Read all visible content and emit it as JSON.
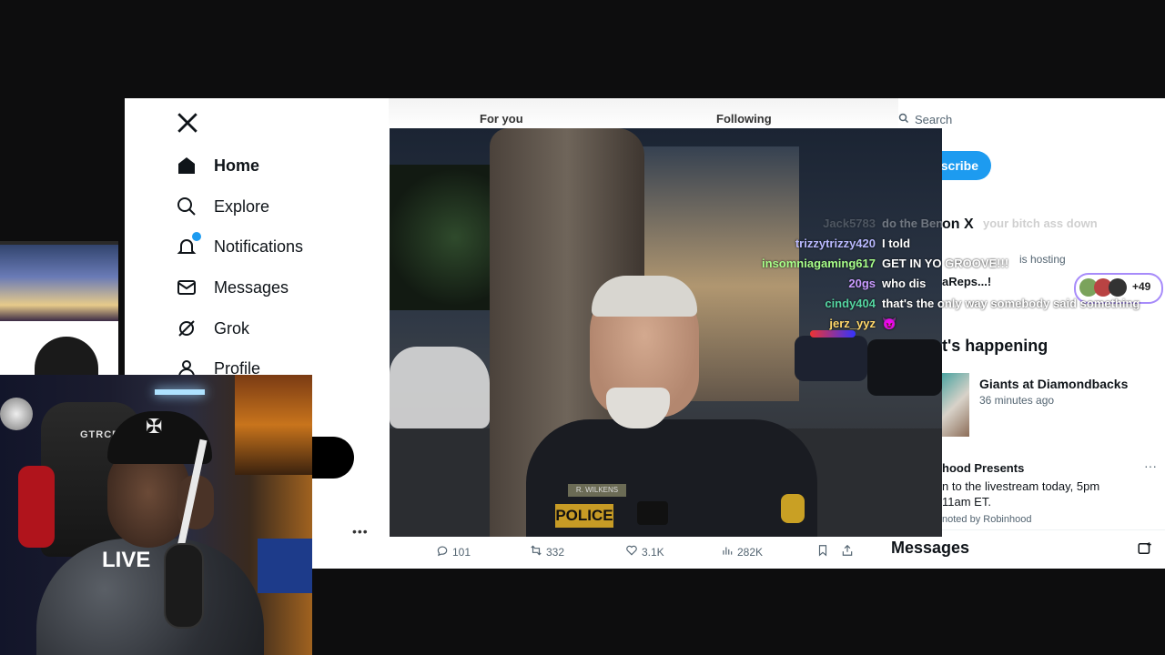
{
  "x_sidebar": {
    "items": [
      {
        "label": "Home"
      },
      {
        "label": "Explore"
      },
      {
        "label": "Notifications",
        "badge": "1"
      },
      {
        "label": "Messages"
      },
      {
        "label": "Grok"
      },
      {
        "label": "Profile"
      }
    ]
  },
  "tabs": {
    "for_you": "For you",
    "following": "Following"
  },
  "search": {
    "placeholder": "Search"
  },
  "right": {
    "subscribe": "scribe",
    "whats_happening": "t's happening",
    "trend1_title": "Giants at Diamondbacks",
    "trend1_time": "36 minutes ago",
    "promo_title": "hood Presents",
    "promo_line1": "n to the livestream today, 5pm",
    "promo_line2": "11am ET.",
    "promo_by": "noted by Robinhood",
    "more": "···",
    "messages_title": "Messages"
  },
  "post_actions": {
    "replies": "101",
    "reposts": "332",
    "likes": "3.1K",
    "views": "282K"
  },
  "video": {
    "police_text": "POLICE",
    "nametag": "R. WILKENS"
  },
  "chat": [
    {
      "user": "Jack5783",
      "msg": "do the Ben",
      "color": "#9aa0a6",
      "faded": true
    },
    {
      "user": "trizzytrizzy420",
      "msg": "I told",
      "color": "#b9b9ff"
    },
    {
      "user": "insomniagaming617",
      "msg": "GET IN YO GROOVE!!!",
      "color": "#a8ff8a"
    },
    {
      "user": "20gs",
      "msg": "who dis",
      "color": "#c99bff"
    },
    {
      "user": "cindy404",
      "msg": "that's the only way somebody said something",
      "color": "#55d6a2"
    },
    {
      "user": "jerz_yyz",
      "msg": "😈",
      "color": "#ffd76a"
    }
  ],
  "chat_bg_text": {
    "bitch_line": "your bitch ass down",
    "on_x": "on X",
    "hosting": "is hosting",
    "reps": "aReps...!",
    "plus": "+49"
  },
  "webcam": {
    "chair_brand": "GTRCE",
    "shirt": "LIVE"
  }
}
